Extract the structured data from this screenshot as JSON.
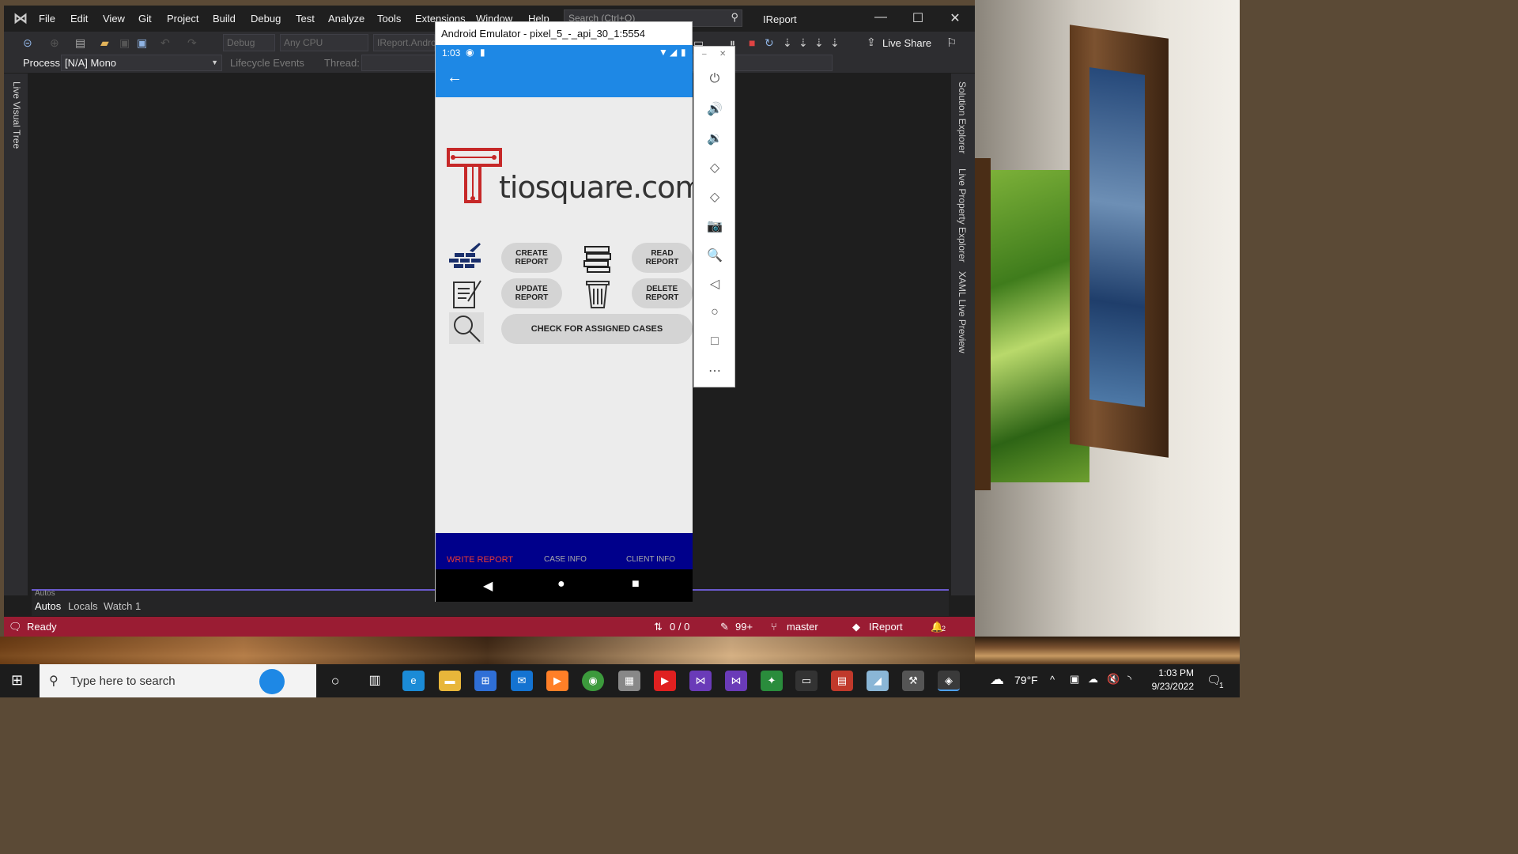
{
  "vs": {
    "menu": [
      "File",
      "Edit",
      "View",
      "Git",
      "Project",
      "Build",
      "Debug",
      "Test",
      "Analyze",
      "Tools",
      "Extensions",
      "Window",
      "Help"
    ],
    "search_placeholder": "Search (Ctrl+Q)",
    "project_name": "IReport",
    "toolbar": {
      "config": "Debug",
      "platform": "Any CPU",
      "startup": "IReport.Andro",
      "live_share": "Live Share"
    },
    "debugbar": {
      "process_label": "Process:",
      "process_value": "[N/A] Mono",
      "lifecycle": "Lifecycle Events",
      "thread_label": "Thread:"
    },
    "left_rail": [
      "Live Visual Tree"
    ],
    "right_rail": [
      "Solution Explorer",
      "Live Property Explorer",
      "XAML Live Preview"
    ],
    "bottom_tabs": [
      "Autos",
      "Locals",
      "Watch 1"
    ],
    "bottom_panel_title": "Autos",
    "status": {
      "ready": "Ready",
      "lines": "0 / 0",
      "changes": "99+",
      "branch": "master",
      "repo": "IReport",
      "notifications": "2"
    }
  },
  "emulator": {
    "title": "Android Emulator - pixel_5_-_api_30_1:5554",
    "phone": {
      "time": "1:03",
      "logo_text": "tiosquare.com",
      "buttons": {
        "create": "CREATE REPORT",
        "read": "READ REPORT",
        "update": "UPDATE REPORT",
        "delete": "DELETE REPORT",
        "check": "CHECK FOR ASSIGNED CASES"
      },
      "tabs": [
        "WRITE REPORT",
        "CASE INFO",
        "CLIENT INFO"
      ],
      "active_tab_color": "#e53935",
      "appbar_color": "#1e88e5",
      "tabbar_color": "#00008b"
    },
    "side_tools": [
      "power-icon",
      "volume-up-icon",
      "volume-down-icon",
      "rotate-left-icon",
      "rotate-right-icon",
      "camera-icon",
      "zoom-icon",
      "back-icon",
      "home-icon",
      "overview-icon",
      "more-icon"
    ]
  },
  "taskbar": {
    "search_placeholder": "Type here to search",
    "weather": "79°F",
    "time": "1:03 PM",
    "date": "9/23/2022",
    "notification_count": "1"
  }
}
